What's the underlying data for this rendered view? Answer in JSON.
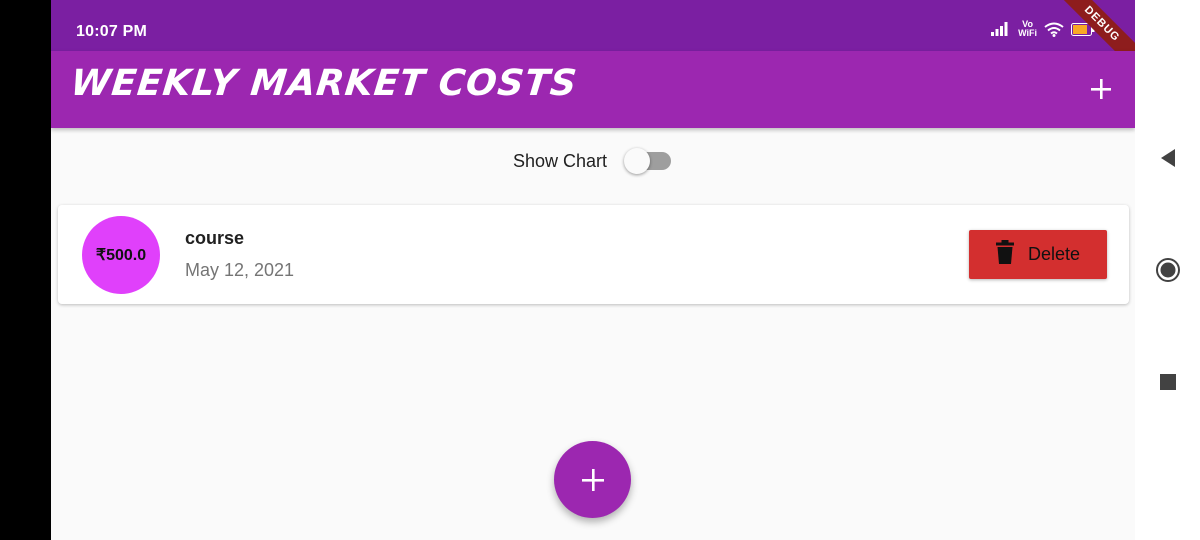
{
  "status_bar": {
    "time": "10:07 PM",
    "vowifi_line1": "Vo",
    "vowifi_line2": "WiFi",
    "battery_level": "77",
    "icons": [
      "signal-icon",
      "vowifi-icon",
      "wifi-icon",
      "battery-icon"
    ]
  },
  "debug_banner": "DEBUG",
  "app_bar": {
    "title": "WEEKLY MARKET COSTS",
    "add_icon": "plus-icon"
  },
  "chart_toggle": {
    "label": "Show Chart",
    "on": false
  },
  "transactions": [
    {
      "amount": "₹500.0",
      "title": "course",
      "date": "May 12, 2021",
      "delete_label": "Delete",
      "delete_icon": "trash-icon"
    }
  ],
  "fab": {
    "icon": "plus-icon"
  },
  "nav": {
    "icons": [
      "back-icon",
      "home-icon",
      "recents-icon"
    ]
  },
  "colors": {
    "status_bar": "#7b1fa2",
    "primary": "#9c27b0",
    "avatar": "#e040fb",
    "delete": "#d32f2f",
    "background": "#fafafa"
  }
}
